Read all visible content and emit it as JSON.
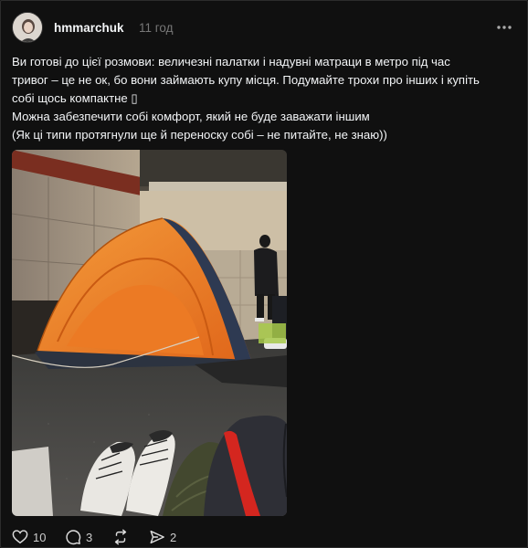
{
  "post": {
    "author": "hmmarchuk",
    "time": "11 год",
    "text_lines": [
      "Ви готові до цієї розмови: величезні палатки і надувні матраци в метро під час",
      "тривог – це не ок, бо вони займають купу місця. Подумайте трохи про інших і купіть",
      "собі щось компактне ▯",
      "Можна забезпечити собі комфорт, який не буде заважати іншим",
      "(Як ці типи протягнули ще й переноску собі – не питайте, не знаю))"
    ],
    "image": {
      "description_icon": "photo-tent-metro"
    }
  },
  "actions": {
    "likes": "10",
    "comments": "3",
    "reposts": "",
    "shares": "2"
  },
  "icons": {
    "more": "more-horizontal-icon",
    "like": "heart-icon",
    "comment": "comment-icon",
    "repost": "repost-icon",
    "share": "share-icon"
  },
  "colors": {
    "background": "#101010",
    "text": "#f3f5f7",
    "muted": "#777777",
    "tent_orange": "#f07a1f"
  }
}
